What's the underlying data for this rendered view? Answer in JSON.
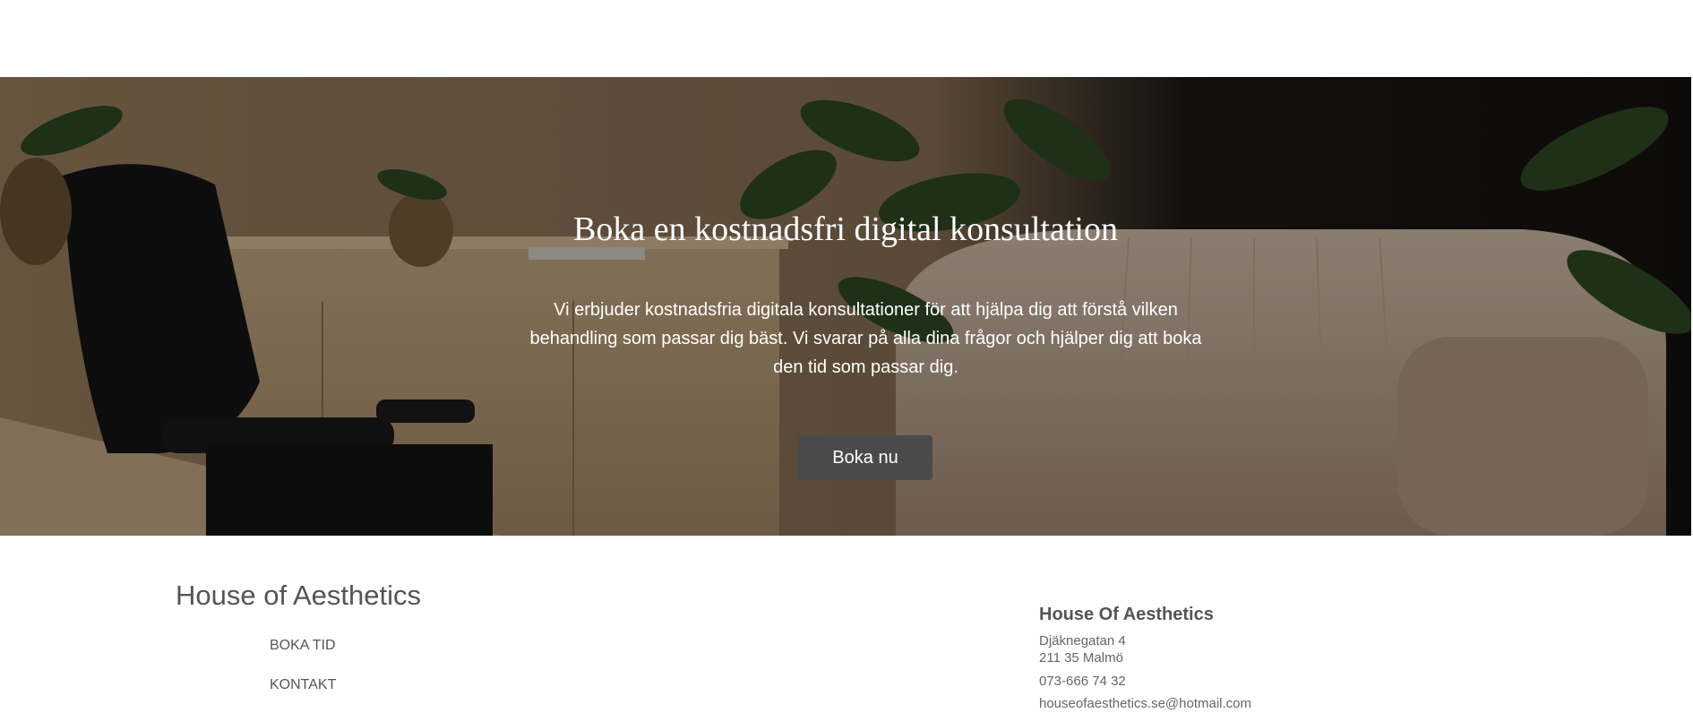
{
  "hero": {
    "title": "Boka en kostnadsfri digital konsultation",
    "text": "Vi erbjuder kostnadsfria digitala konsultationer för att hjälpa dig att förstå vilken behandling som passar dig bäst. Vi svarar på alla dina frågor och hjälper dig att boka den tid som passar dig.",
    "button_label": "Boka nu"
  },
  "footer": {
    "brand": "House of Aesthetics",
    "nav": [
      {
        "label": "BOKA TID"
      },
      {
        "label": "KONTAKT"
      }
    ],
    "contact": {
      "name": "House Of Aesthetics",
      "street": "Djäknegatan 4",
      "city": "211 35 Malmö",
      "phone": "073-666 74 32",
      "email": "houseofaesthetics.se@hotmail.com"
    }
  }
}
